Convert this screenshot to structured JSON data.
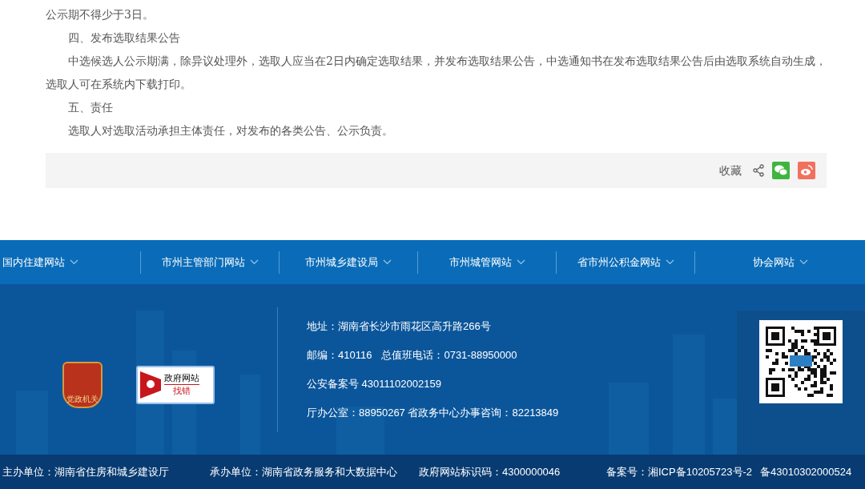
{
  "article": {
    "paragraphs": [
      {
        "text": "公示期不得少于3日。",
        "indent": false
      },
      {
        "text": "四、发布选取结果公告",
        "indent": true
      },
      {
        "text": "中选候选人公示期满，除异议处理外，选取人应当在2日内确定选取结果，并发布选取结果公告，中选通知书在发布选取结果公告后由选取系统自动生成，选取人可在系统内下载打印。",
        "indent": true
      },
      {
        "text": "五、责任",
        "indent": true
      },
      {
        "text": "选取人对选取活动承担主体责任，对发布的各类公告、公示负责。",
        "indent": true
      }
    ]
  },
  "share_bar": {
    "favorite": "收藏"
  },
  "nav_links": [
    {
      "label": "国内住建网站"
    },
    {
      "label": "市州主管部门网站"
    },
    {
      "label": "市州城乡建设局"
    },
    {
      "label": "市州城管网站"
    },
    {
      "label": "省市州公积金网站"
    },
    {
      "label": "协会网站"
    }
  ],
  "footer": {
    "party_badge": "党政机关",
    "error_report": {
      "line_1": "政府网站",
      "line_2": "找错"
    },
    "contact_lines": [
      {
        "parts": [
          "地址：湖南省长沙市雨花区高升路266号"
        ]
      },
      {
        "parts": [
          "邮编：410116",
          "总值班电话：0731-88950000"
        ]
      },
      {
        "parts": [
          "公安备案号 43011102002159"
        ]
      },
      {
        "parts": [
          "厅办公室：88950267 省政务中心办事咨询：82213849"
        ]
      }
    ]
  },
  "bottom_bar": [
    "主办单位：湖南省住房和城乡建设厅",
    "承办单位：湖南省政务服务和大数据中心",
    "政府网站标识码：4300000046",
    "备案号：湘ICP备10205723号-2",
    "备43010302000524"
  ]
}
